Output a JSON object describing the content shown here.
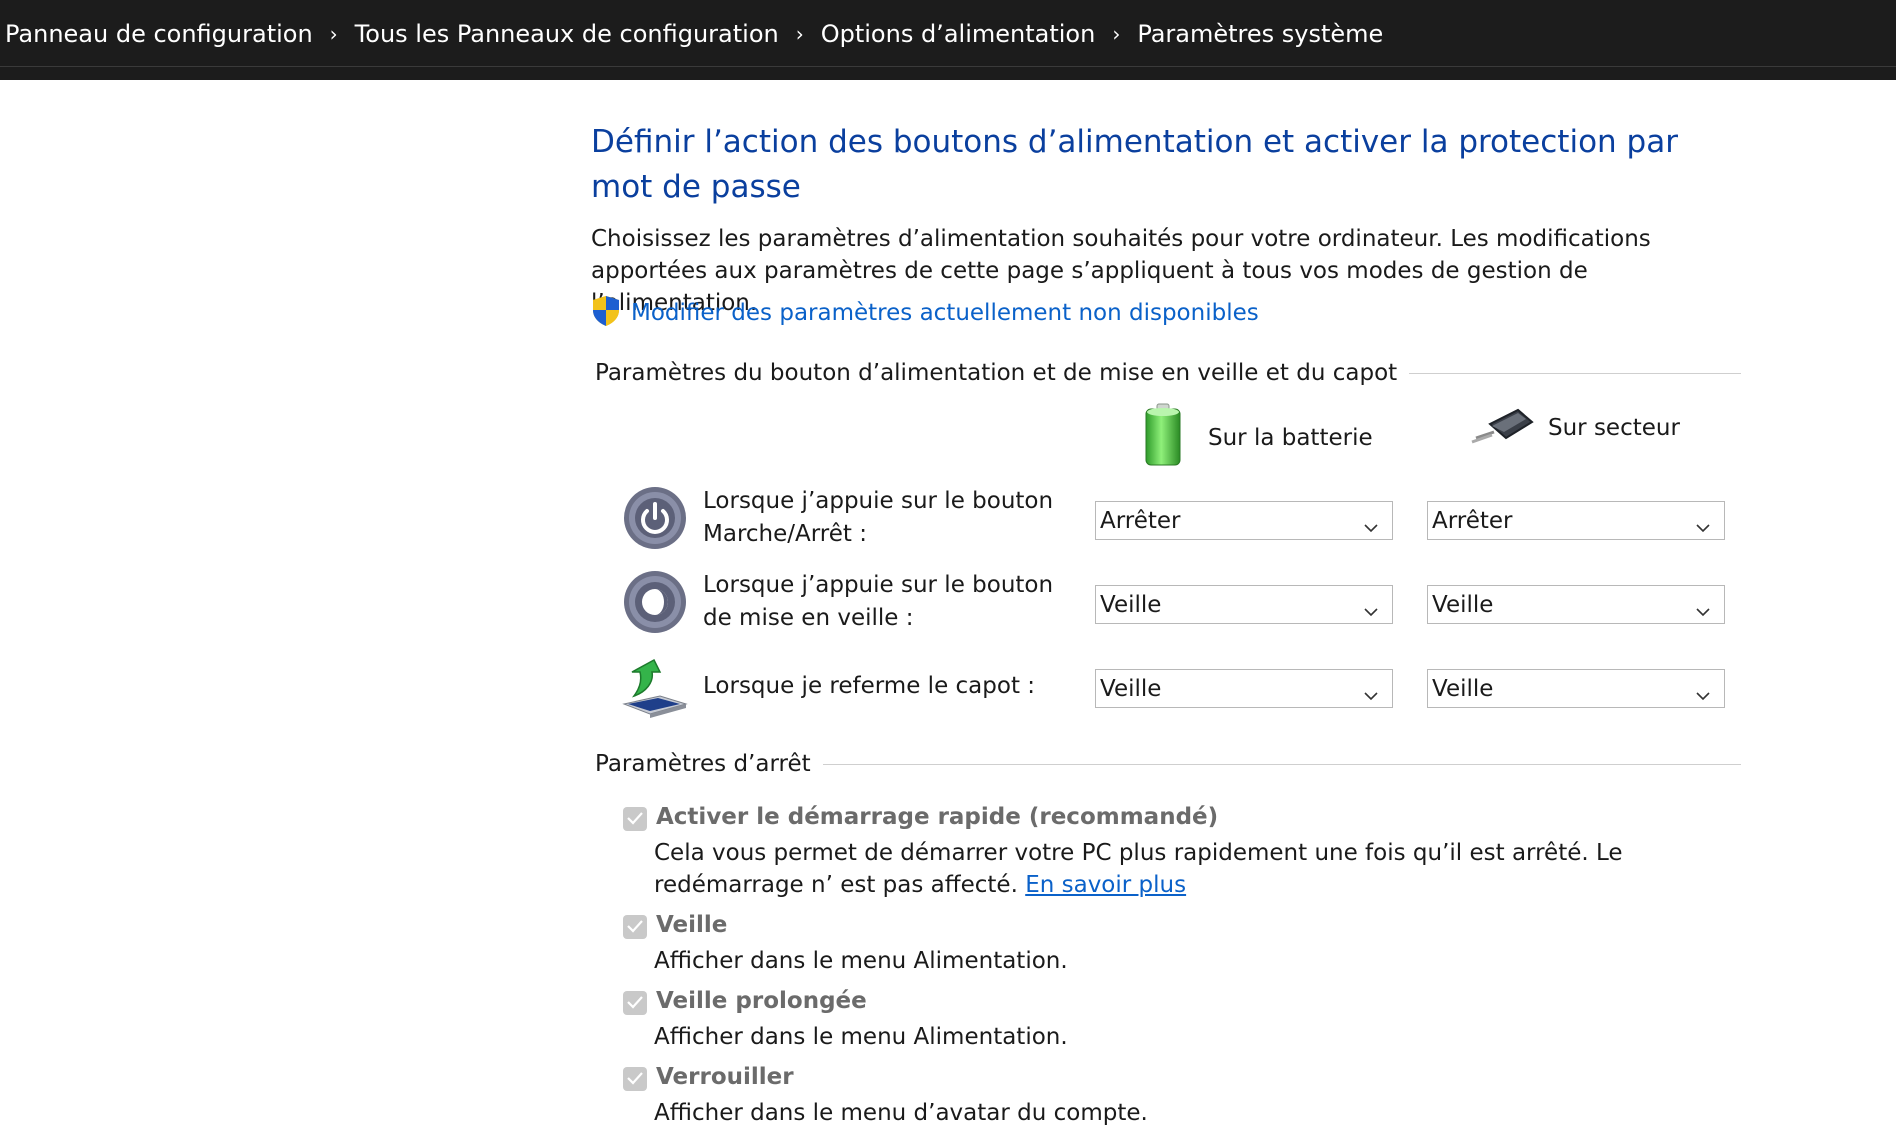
{
  "breadcrumb": {
    "items": [
      "Panneau de configuration",
      "Tous les Panneaux de configuration",
      "Options d’alimentation",
      "Paramètres système"
    ],
    "separator": "›"
  },
  "page": {
    "title": "Définir l’action des boutons d’alimentation et activer la protection par mot de passe",
    "description": "Choisissez les paramètres d’alimentation souhaités pour votre ordinateur. Les modifications apportées aux paramètres de cette page s’appliquent à tous vos modes de gestion de l’alimentation.",
    "uac_link": "Modifier des paramètres actuellement non disponibles"
  },
  "buttons_section": {
    "label": "Paramètres du bouton d’alimentation et de mise en veille et du capot",
    "columns": {
      "battery": "Sur la batterie",
      "plugged": "Sur secteur"
    },
    "rows": [
      {
        "label": "Lorsque j’appuie sur le bouton Marche/Arrêt :",
        "battery": "Arrêter",
        "plugged": "Arrêter",
        "icon": "power-button-icon"
      },
      {
        "label": "Lorsque j’appuie sur le bouton de mise en veille :",
        "battery": "Veille",
        "plugged": "Veille",
        "icon": "sleep-button-icon"
      },
      {
        "label": "Lorsque je referme le capot :",
        "battery": "Veille",
        "plugged": "Veille",
        "icon": "laptop-lid-icon"
      }
    ]
  },
  "shutdown_section": {
    "label": "Paramètres d’arrêt",
    "options": [
      {
        "title": "Activer le démarrage rapide (recommandé)",
        "desc": "Cela vous permet de démarrer votre PC plus rapidement une fois qu’il est arrêté. Le redémarrage n’ est pas affecté.",
        "link": "En savoir plus",
        "checked": true
      },
      {
        "title": "Veille",
        "desc": "Afficher dans le menu Alimentation.",
        "checked": true
      },
      {
        "title": "Veille prolongée",
        "desc": "Afficher dans le menu Alimentation.",
        "checked": true
      },
      {
        "title": "Verrouiller",
        "desc": "Afficher dans le menu d’avatar du compte.",
        "checked": true
      }
    ]
  },
  "colors": {
    "title": "#0a3f9e",
    "link": "#0a61c9",
    "topbar": "#1c1c1c"
  }
}
